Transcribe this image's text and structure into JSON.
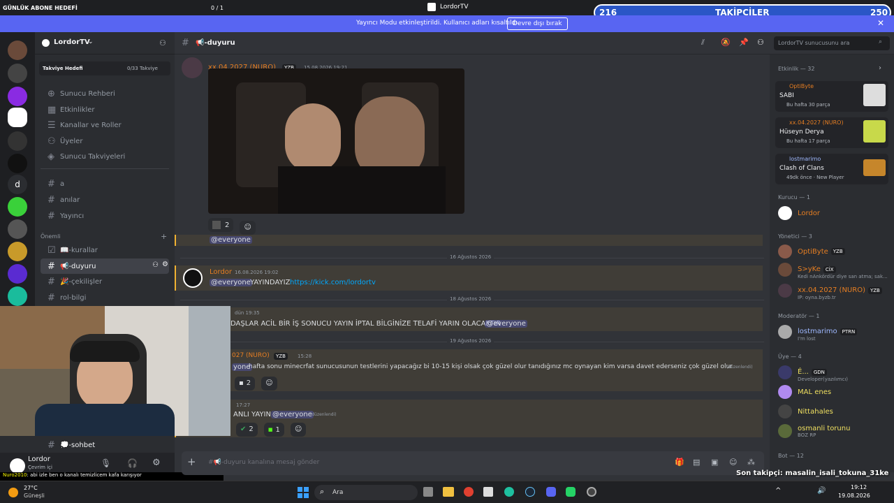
{
  "overlay": {
    "goal_label": "GÜNLÜK ABONE HEDEFİ",
    "goal_value": "0 / 1",
    "window_title": "LordorTV",
    "followers_current": "216",
    "followers_label": "TAKİPÇİLER",
    "followers_target": "250",
    "streamer_notice": "Yayıncı Modu etkinleştirildi. Kullanıcı adları kısaltıldı.",
    "disable_button": "Devre dışı bırak",
    "last_follower": "Son takipçi: masalin_isali_tokuna_31ke",
    "chat_user": "Nuro2010",
    "chat_msg": ": abi izle ben o kanalı temizlicem kafa karışıyor"
  },
  "server": {
    "name": "LordorTV",
    "boost_label": "Takviye Hedefi",
    "boost_value": "0/33 Takviye",
    "nav": [
      "Sunucu Rehberi",
      "Etkinlikler",
      "Kanallar ve Roller",
      "Üyeler",
      "Sunucu Takviyeleri"
    ],
    "channels_top": [
      "a",
      "anılar",
      "Yayıncı"
    ],
    "category": "Önemli",
    "channels_cat": [
      "📖-kurallar",
      "📢-duyuru",
      "🎉-çekilişler",
      "rol-bilgi"
    ],
    "bottom_channel": "💭-sohbet"
  },
  "user": {
    "name": "Lordor",
    "status": "Çevrim içi"
  },
  "channel": {
    "name": "📢-duyuru",
    "search_placeholder": "LordorTV sunucusunu ara",
    "input_placeholder": "#📢-duyuru kanalına mesaj gönder"
  },
  "messages": {
    "m1_author": "xx.04.2027 (NURO)",
    "m1_badge": "YZB",
    "m1_time": "15.08.2026 19:21",
    "m1_react_count": "2",
    "m1_text": "@everyone",
    "div1": "16 Ağustos 2026",
    "m2_author": "Lordor",
    "m2_time": "16.08.2026 19:02",
    "m2_mention": "@everyone",
    "m2_text": "YAYINDAYIZ",
    "m2_link": "https://kick.com/lordortv",
    "div2": "18 Ağustos 2026",
    "m3_time": "dün 19:35",
    "m3_text": "DAŞLAR ACİL BİR İŞ SONUCU YAYIN İPTAL BİLGİNİZE TELAFİ YARIN OLACAKTIR",
    "m3_mention": "@everyone",
    "div3": "19 Ağustos 2026",
    "m4_author": "027 (NURO)",
    "m4_badge": "YZB",
    "m4_time": "15:28",
    "m4_mention": "yone",
    "m4_text": "hafta sonu minecrfat sunucusunun testlerini yapacağız bi 10-15 kişi olsak çok güzel olur tanıdığınız mc oynayan kim varsa davet ederseniz çok güzel olur",
    "m4_edited": "(düzenlendi)",
    "m4_react_count": "2",
    "m5_time": "17:27",
    "m5_text": "ANLI YAYIN",
    "m5_mention": "@everyone",
    "m5_edited": "(düzenlendi)",
    "m5_react1": "2",
    "m5_react2": "1"
  },
  "activity": {
    "label": "Etkinlik — 32",
    "items": [
      {
        "user": "OptiByte",
        "title": "SABI",
        "sub": "Bu hafta 30 parça"
      },
      {
        "user": "xx.04.2027 (NURO)",
        "title": "Hüseyn Derya",
        "sub": "Bu hafta 17 parça"
      },
      {
        "user": "lostmarimo",
        "title": "Clash of Clans",
        "sub": "49dk önce  ·  New Player"
      }
    ]
  },
  "members": {
    "kurucu": "Kurucu — 1",
    "kurucu_name": "Lordor",
    "yonetici": "Yönetici — 3",
    "y1": "OptiByte",
    "y1_tag": "YZB",
    "y2": "S>yKe",
    "y2_tag": "CİX",
    "y2_sub": "Kedi nAnkördür diye san atma; sak...",
    "y3": "xx.04.2027 (NURO)",
    "y3_tag": "YZB",
    "y3_sub": "IP: oyna.byzb.tr",
    "moderator": "Moderatör — 1",
    "m1": "lostmarimo",
    "m1_tag": "PTRN",
    "m1_sub": "I'm lost",
    "uye": "Üye — 4",
    "u1": "É...",
    "u1_tag": "GDN",
    "u1_sub": "Developer(yazılımcı)",
    "u2": "MAL enes",
    "u3": "Nittahales",
    "u4": "osmanli torunu",
    "u4_sub": "BOZ RP",
    "bot": "Bot — 12"
  },
  "taskbar": {
    "weather_temp": "27°C",
    "weather_desc": "Güneşli",
    "search": "Ara",
    "time": "19:12",
    "date": "19.08.2026"
  },
  "colors": {
    "accent": "#5865f2",
    "gold": "#f0b232",
    "orange": "#e67e22"
  }
}
